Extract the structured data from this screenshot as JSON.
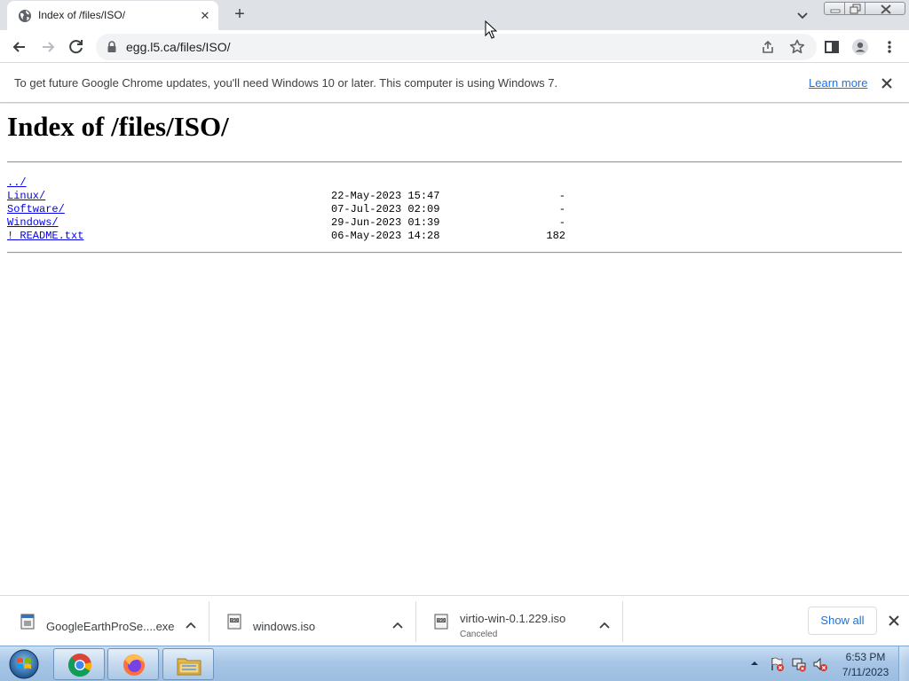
{
  "browser": {
    "tab": {
      "title": "Index of /files/ISO/",
      "favicon": "globe-icon"
    },
    "omnibox": {
      "url": "egg.l5.ca/files/ISO/"
    },
    "infobar": {
      "message": "To get future Google Chrome updates, you'll need Windows 10 or later. This computer is using Windows 7.",
      "link_label": "Learn more"
    }
  },
  "page": {
    "title": "Index of /files/ISO/",
    "parent_link": "../",
    "entries": [
      {
        "name": "Linux/",
        "date": "22-May-2023 15:47",
        "size": "-"
      },
      {
        "name": "Software/",
        "date": "07-Jul-2023 02:09",
        "size": "-"
      },
      {
        "name": "Windows/",
        "date": "29-Jun-2023 01:39",
        "size": "-"
      },
      {
        "name": "! README.txt",
        "date": "06-May-2023 14:28",
        "size": "182"
      }
    ]
  },
  "downloads": {
    "items": [
      {
        "name": "GoogleEarthProSe....exe",
        "status": "",
        "icon": "executable-file-icon"
      },
      {
        "name": "windows.iso",
        "status": "",
        "icon": "iso-file-icon"
      },
      {
        "name": "virtio-win-0.1.229.iso",
        "status": "Canceled",
        "icon": "iso-file-icon"
      }
    ],
    "show_all_label": "Show all"
  },
  "taskbar": {
    "time": "6:53 PM",
    "date": "7/11/2023"
  },
  "colors": {
    "link": "#0000ee",
    "chrome_blue": "#1a73e8",
    "tabstrip_bg": "#dee1e6"
  }
}
